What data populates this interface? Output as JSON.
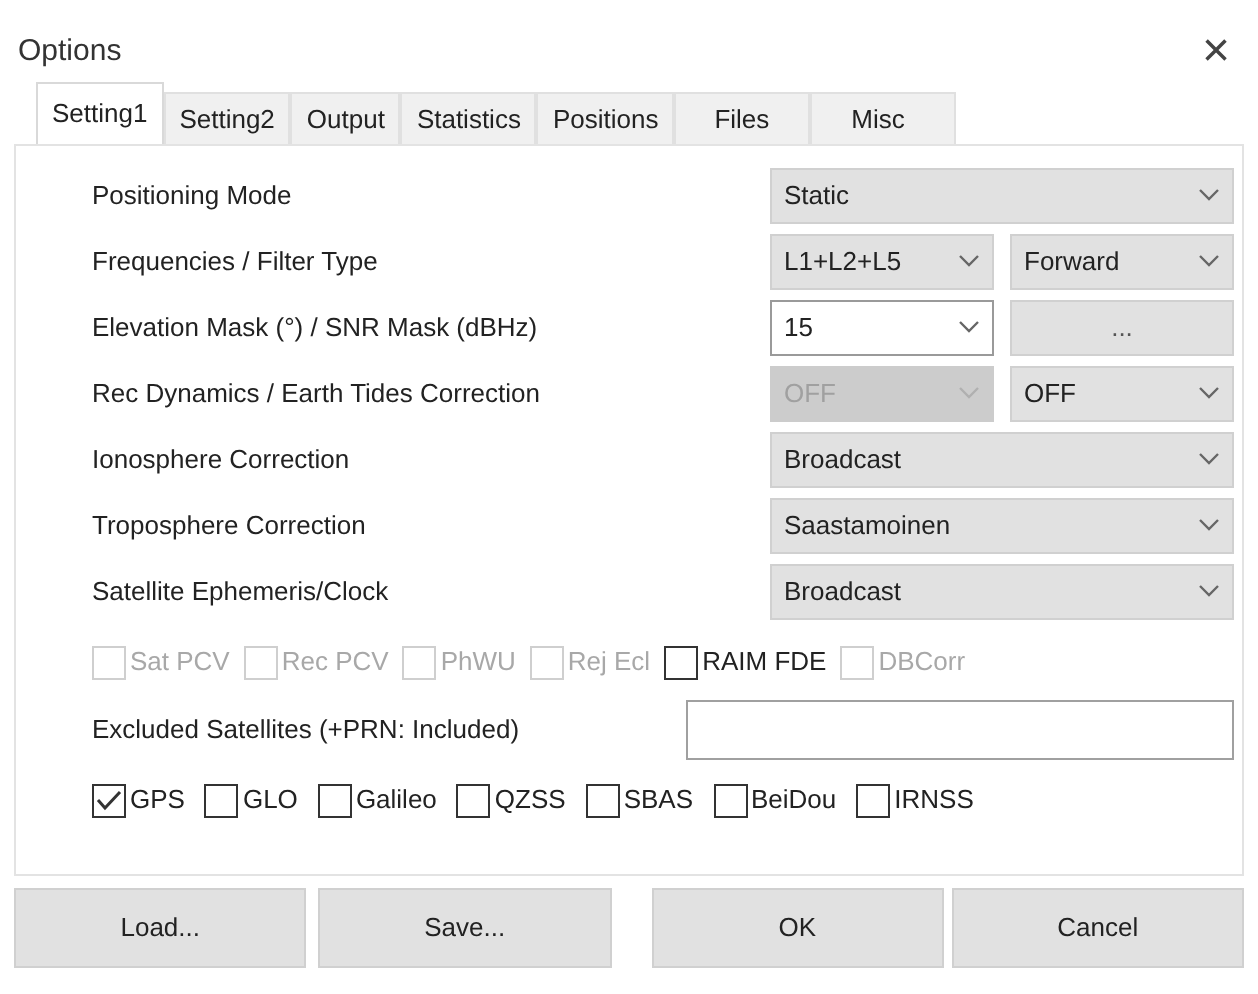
{
  "window": {
    "title": "Options",
    "close": "×"
  },
  "tabs": [
    {
      "label": "Setting1",
      "selected": true
    },
    {
      "label": "Setting2",
      "selected": false
    },
    {
      "label": "Output",
      "selected": false
    },
    {
      "label": "Statistics",
      "selected": false
    },
    {
      "label": "Positions",
      "selected": false
    },
    {
      "label": "Files",
      "selected": false
    },
    {
      "label": "Misc",
      "selected": false
    }
  ],
  "settings": [
    {
      "label": "Positioning Mode",
      "controls": [
        {
          "kind": "combo",
          "value": "Static",
          "disabled": false
        }
      ]
    },
    {
      "label": "Frequencies / Filter Type",
      "controls": [
        {
          "kind": "combo",
          "value": "L1+L2+L5",
          "disabled": false
        },
        {
          "kind": "combo",
          "value": "Forward",
          "disabled": false
        }
      ]
    },
    {
      "label": "Elevation Mask (°) / SNR Mask (dBHz)",
      "controls": [
        {
          "kind": "edit",
          "value": "15",
          "disabled": false
        },
        {
          "kind": "button",
          "value": "...",
          "disabled": false
        }
      ]
    },
    {
      "label": "Rec Dynamics / Earth Tides Correction",
      "controls": [
        {
          "kind": "combo",
          "value": "OFF",
          "disabled": true
        },
        {
          "kind": "combo",
          "value": "OFF",
          "disabled": false
        }
      ]
    },
    {
      "label": "Ionosphere Correction",
      "controls": [
        {
          "kind": "combo",
          "value": "Broadcast",
          "disabled": false
        }
      ]
    },
    {
      "label": "Troposphere Correction",
      "controls": [
        {
          "kind": "combo",
          "value": "Saastamoinen",
          "disabled": false
        }
      ]
    },
    {
      "label": "Satellite Ephemeris/Clock",
      "controls": [
        {
          "kind": "combo",
          "value": "Broadcast",
          "disabled": false
        }
      ]
    }
  ],
  "options": [
    {
      "label": "Sat PCV",
      "checked": false,
      "disabled": true
    },
    {
      "label": "Rec PCV",
      "checked": false,
      "disabled": true
    },
    {
      "label": "PhWU",
      "checked": false,
      "disabled": true
    },
    {
      "label": "Rej Ecl",
      "checked": false,
      "disabled": true
    },
    {
      "label": "RAIM FDE",
      "checked": false,
      "disabled": false
    },
    {
      "label": "DBCorr",
      "checked": false,
      "disabled": true
    }
  ],
  "excluded_satellites": {
    "label": "Excluded Satellites (+PRN: Included)"
  },
  "systems": [
    {
      "label": "GPS",
      "checked": true
    },
    {
      "label": "GLO",
      "checked": false
    },
    {
      "label": "Galileo",
      "checked": false
    },
    {
      "label": "QZSS",
      "checked": false
    },
    {
      "label": "SBAS",
      "checked": false
    },
    {
      "label": "BeiDou",
      "checked": false
    },
    {
      "label": "IRNSS",
      "checked": false
    }
  ],
  "buttons": [
    "Load...",
    "Save...",
    "OK",
    "Cancel"
  ]
}
